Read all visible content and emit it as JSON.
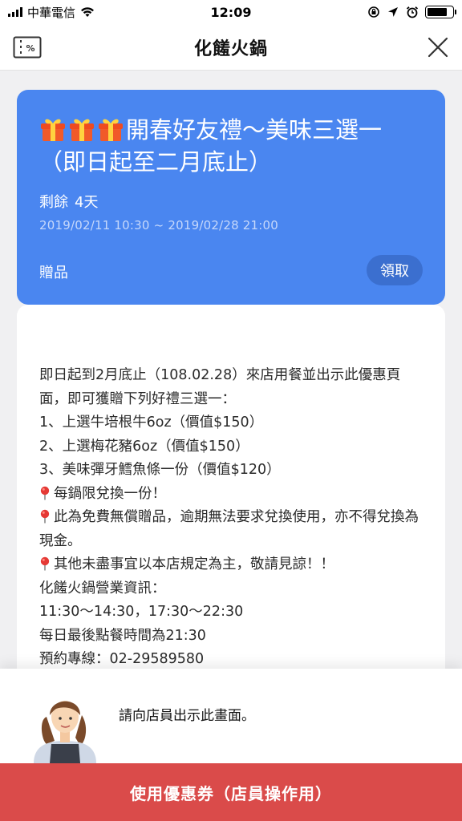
{
  "status_bar": {
    "carrier": "中華電信",
    "time": "12:09"
  },
  "nav": {
    "title": "化饈火鍋",
    "left_icon": "coupon-icon",
    "right_icon": "close-icon"
  },
  "coupon": {
    "title": "開春好友禮～美味三選一（即日起至二月底止）",
    "gift_icon": "gift-icon",
    "remaining_label": "剩餘",
    "remaining_value": "4天",
    "date_range": "2019/02/11 10:30 ~ 2019/02/28 21:00",
    "type_label": "贈品",
    "claim_label": "領取",
    "background_color": "#4a86f0"
  },
  "description": {
    "lines": [
      "即日起到2月底止（108.02.28）來店用餐並出示此優惠頁面，即可獲贈下列好禮三選一：",
      "1、上選牛培根牛6oz（價值$150）",
      "2、上選梅花豬6oz（價值$150）",
      "3、美味彈牙鱈魚條一份（價值$120）",
      "每鍋限兌換一份！",
      "此為免費無償贈品，逾期無法要求兌換使用，亦不得兌換為現金。",
      "其他未盡事宜以本店規定為主，敬請見諒！！",
      "化饈火鍋營業資訊：",
      "11:30～14:30，17:30～22:30",
      "每日最後點餐時間為21:30",
      "預約專線：02-29589580"
    ],
    "pin_icon": "pin-icon"
  },
  "sheet": {
    "message": "請向店員出示此畫面。"
  },
  "use_button": {
    "label": "使用優惠券（店員操作用）",
    "color": "#da4b4a"
  }
}
